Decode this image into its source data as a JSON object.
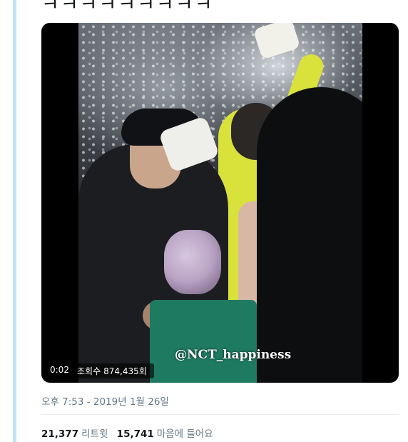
{
  "tweet": {
    "text": "ㅋㅋㅋㅋㅋㅋㅋㅋㅋ",
    "timestamp": "오후 7:53 - 2019년 1월 26일"
  },
  "video": {
    "elapsed": "0:02",
    "views_label": "조회수",
    "views_count": "874,435회",
    "watermark": "@NCT_happiness"
  },
  "stats": {
    "retweets_count": "21,377",
    "retweets_label": "리트윗",
    "likes_count": "15,741",
    "likes_label": "마음에 들어요"
  },
  "colors": {
    "thread_line": "#bfe3f4",
    "secondary_text": "#657786",
    "primary_text": "#14171a"
  }
}
